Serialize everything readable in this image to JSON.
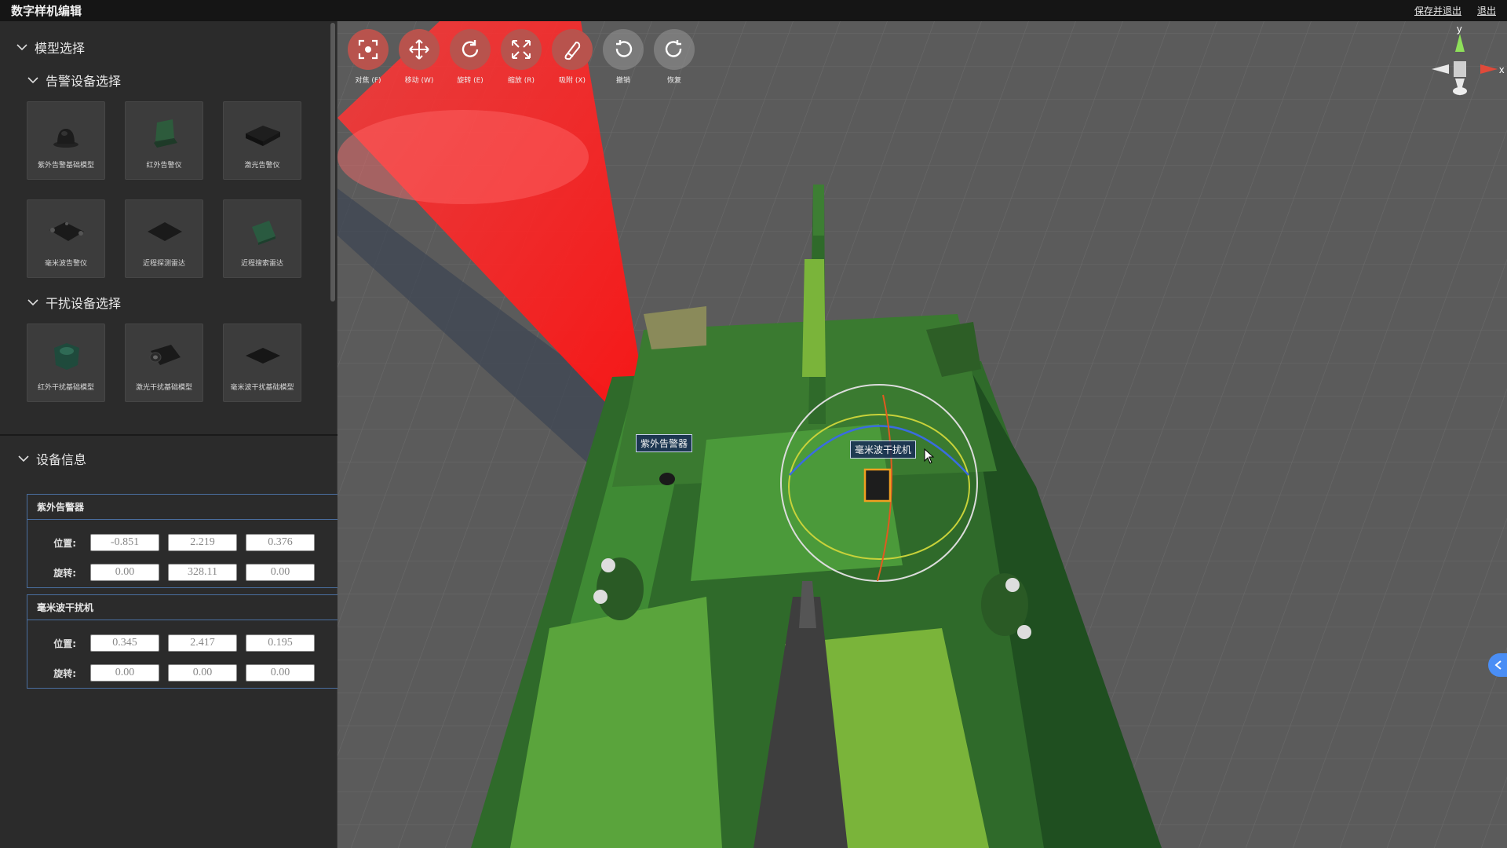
{
  "app": {
    "title": "数字样机编辑",
    "save_exit": "保存并退出",
    "exit": "退出"
  },
  "left_panel": {
    "model_select_title": "模型选择",
    "alarm_section": {
      "title": "告警设备选择",
      "items": [
        {
          "label": "紫外告警基础模型",
          "icon": "uv-alarm-dome-icon"
        },
        {
          "label": "红外告警仪",
          "icon": "ir-alarm-box-icon"
        },
        {
          "label": "激光告警仪",
          "icon": "laser-alarm-icon"
        },
        {
          "label": "毫米波告警仪",
          "icon": "mmw-alarm-icon"
        },
        {
          "label": "近程探测雷达",
          "icon": "short-range-radar-icon"
        },
        {
          "label": "近程搜索雷达",
          "icon": "search-radar-icon"
        }
      ]
    },
    "jammer_section": {
      "title": "干扰设备选择",
      "items": [
        {
          "label": "红外干扰基础模型",
          "icon": "ir-jammer-icon"
        },
        {
          "label": "激光干扰基础模型",
          "icon": "laser-jammer-icon"
        },
        {
          "label": "毫米波干扰基础模型",
          "icon": "mmw-jammer-icon"
        }
      ]
    },
    "device_info": {
      "title": "设备信息",
      "position_label": "位置:",
      "rotation_label": "旋转:",
      "devices": [
        {
          "name": "紫外告警器",
          "position": [
            "-0.851",
            "2.219",
            "0.376"
          ],
          "rotation": [
            "0.00",
            "328.11",
            "0.00"
          ]
        },
        {
          "name": "毫米波干扰机",
          "position": [
            "0.345",
            "2.417",
            "0.195"
          ],
          "rotation": [
            "0.00",
            "0.00",
            "0.00"
          ]
        }
      ]
    }
  },
  "toolbar": [
    {
      "label": "对焦 (F)",
      "icon": "focus-icon",
      "active": true
    },
    {
      "label": "移动 (W)",
      "icon": "move-icon",
      "active": true
    },
    {
      "label": "旋转 (E)",
      "icon": "rotate-icon",
      "active": true
    },
    {
      "label": "缩放 (R)",
      "icon": "scale-icon",
      "active": true
    },
    {
      "label": "吸附 (X)",
      "icon": "snap-icon",
      "active": true
    },
    {
      "label": "撤销",
      "icon": "undo-icon",
      "active": false
    },
    {
      "label": "恢复",
      "icon": "redo-icon",
      "active": false
    }
  ],
  "scene": {
    "tag_uv": "紫外告警器",
    "tag_mmw": "毫米波干扰机",
    "axis_y": "y",
    "axis_x": "x"
  },
  "colors": {
    "accent_blue": "#4a8ef5",
    "tool_active": "#c0504d",
    "beam_red": "#ff2020",
    "tank_green": "#3f7f2f"
  }
}
